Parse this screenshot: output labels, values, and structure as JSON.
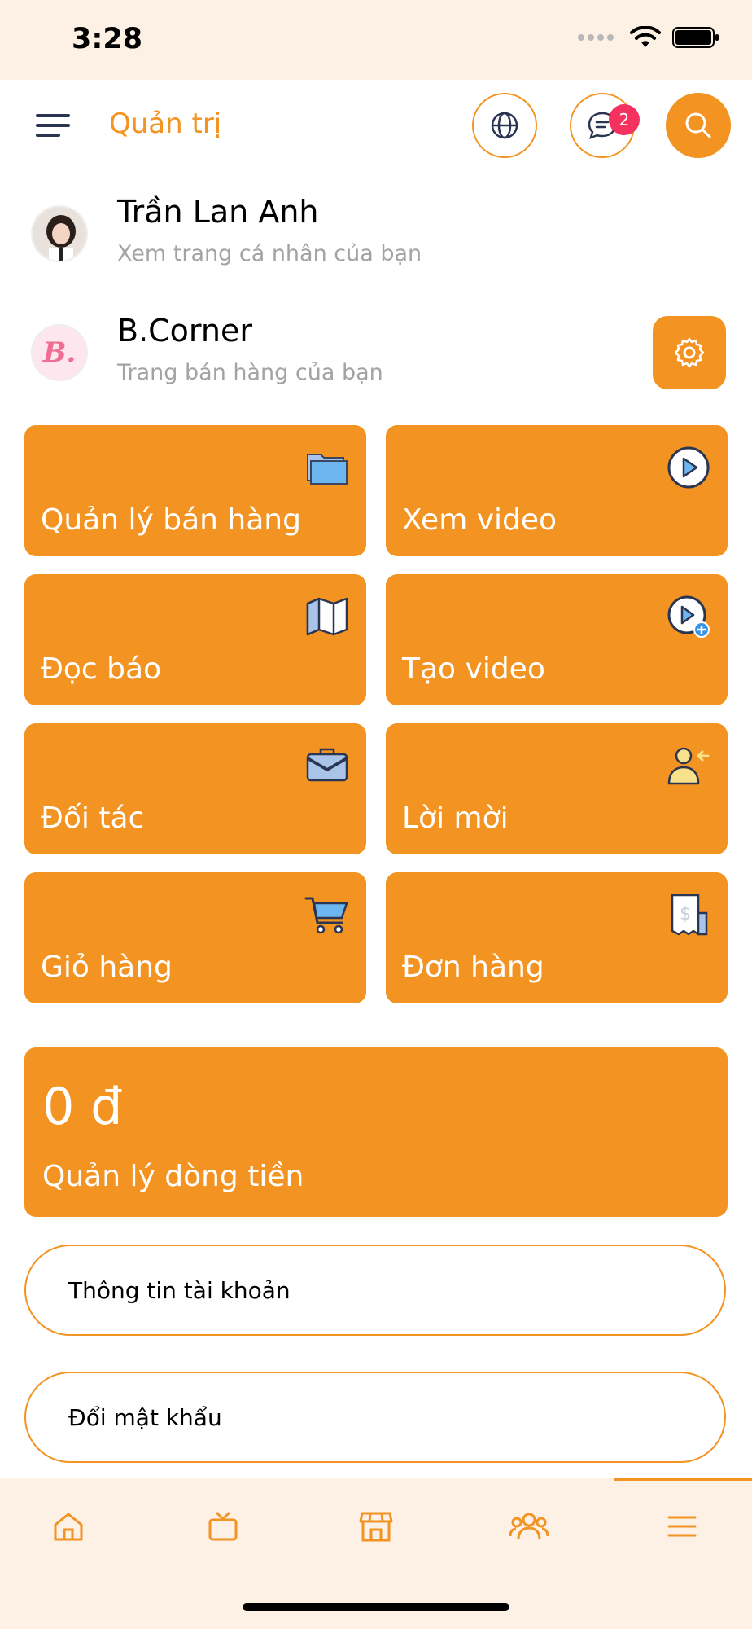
{
  "status_bar": {
    "time": "3:28"
  },
  "header": {
    "title": "Quản trị",
    "chat_badge_count": "2"
  },
  "user": {
    "name": "Trần Lan Anh",
    "subtitle": "Xem trang cá nhân của bạn"
  },
  "shop": {
    "name": "B.Corner",
    "subtitle": "Trang bán hàng của bạn",
    "logo_text": "B."
  },
  "tiles": [
    {
      "label": "Quản lý bán hàng",
      "icon": "folder-icon"
    },
    {
      "label": "Xem video",
      "icon": "play-circle-icon"
    },
    {
      "label": "Đọc báo",
      "icon": "map-icon"
    },
    {
      "label": "Tạo video",
      "icon": "add-video-icon"
    },
    {
      "label": "Đối tác",
      "icon": "briefcase-icon"
    },
    {
      "label": "Lời mời",
      "icon": "invite-user-icon"
    },
    {
      "label": "Giỏ hàng",
      "icon": "cart-icon"
    },
    {
      "label": "Đơn hàng",
      "icon": "receipt-icon"
    }
  ],
  "cash": {
    "amount": "0 đ",
    "label": "Quản lý dòng tiền"
  },
  "buttons": {
    "account_info": "Thông tin tài khoản",
    "change_password": "Đổi mật khẩu"
  },
  "tabbar": {
    "items": [
      "home-icon",
      "tv-icon",
      "store-icon",
      "people-icon",
      "menu-icon"
    ],
    "active_index": 4
  },
  "colors": {
    "accent": "#f39322",
    "badge": "#f5315f",
    "tabbar_bg": "#fdf1e6"
  }
}
